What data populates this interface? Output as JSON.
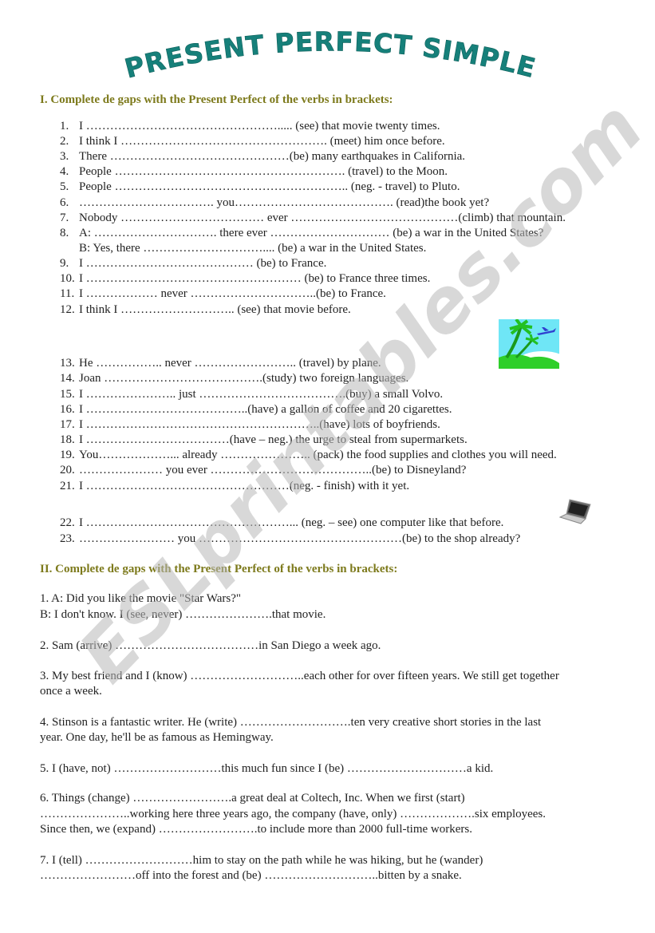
{
  "title": "PRESENT PERFECT SIMPLE",
  "watermark": "ESLprintables.com",
  "colors": {
    "title": "#16807a",
    "heading": "#7d7a1c",
    "watermark": "#bdbdbd"
  },
  "section1": {
    "heading": "I. Complete de gaps with the Present Perfect of the verbs in brackets:",
    "items": [
      {
        "n": "1.",
        "text": "I …………………………………………..... (see) that movie twenty times."
      },
      {
        "n": "2.",
        "text": "I think I ……………………………………………. (meet) him once before."
      },
      {
        "n": "3.",
        "text": "There ………………………………………(be) many earthquakes in California."
      },
      {
        "n": "4.",
        "text": "People …………………………………………………. (travel) to the Moon."
      },
      {
        "n": "5.",
        "text": "People ………………………………………………….. (neg. - travel) to Pluto."
      },
      {
        "n": "6.",
        "text": "……………………………. you…………………………………. (read)the book yet?"
      },
      {
        "n": "7.",
        "text": "Nobody ……………………………… ever ……………………………………(climb) that mountain."
      },
      {
        "n": "8.",
        "text": "A: …………………………. there ever ………………………… (be) a war in the United States?"
      },
      {
        "n": "",
        "text": "B: Yes, there ………………………….... (be) a war in the United States."
      },
      {
        "n": "9.",
        "text": "I …………………………………… (be) to France."
      },
      {
        "n": "10.",
        "text": "I ……………………………………………… (be) to France three times."
      },
      {
        "n": "11.",
        "text": "I ……………… never …………………………..(be) to France."
      },
      {
        "n": "12.",
        "text": "I think I ……………………….. (see) that movie before."
      },
      {
        "n": "13.",
        "text": "He …………….. never  …………………….. (travel) by plane."
      },
      {
        "n": "14.",
        "text": "Joan ………………………………….(study) two foreign languages."
      },
      {
        "n": "15.",
        "text": "I ………………….. just ……………………………….(buy) a small Volvo."
      },
      {
        "n": "16.",
        "text": "I …………………………………..(have) a gallon of coffee and 20 cigarettes."
      },
      {
        "n": "17.",
        "text": "I …………………………………………………..(have) lots of boyfriends."
      },
      {
        "n": "18.",
        "text": "I ………………………………(have – neg.) the urge to steal from supermarkets."
      },
      {
        "n": "19.",
        "text": "You………………... already ………………….. (pack) the food supplies and clothes you will need."
      },
      {
        "n": "20.",
        "text": "………………… you ever …………………………………..(be) to Disneyland?"
      },
      {
        "n": "21.",
        "text": "I ……………………………………………(neg. - finish) with it yet."
      },
      {
        "n": "22.",
        "text": "I ……………………………………………... (neg. – see)  one computer like that before."
      },
      {
        "n": "23.",
        "text": "…………………… you ……………………………………………(be) to the shop already?"
      }
    ]
  },
  "section2": {
    "heading": "II. Complete de gaps with the Present Perfect of the verbs in brackets:",
    "lines": [
      "1. A: Did you like the movie \"Star Wars?\"",
      "B: I don't know. I (see, never) ………………….that movie.",
      "2. Sam (arrive) ………………………………in San Diego a week ago.",
      "3. My best friend and I (know) ………………………..each other for over fifteen years. We still get together",
      "once a week.",
      "4. Stinson is a fantastic writer. He (write) ……………………….ten very creative short stories in the last",
      "year. One day, he'll be as famous as Hemingway.",
      "5. I (have, not) ………………………this much fun since I (be) …………………………a kid.",
      "6. Things (change) …………………….a great deal at Coltech, Inc. When we first (start)",
      "…………………..working here three years ago, the company (have, only) ……………….six employees.",
      "Since then, we (expand) …………………….to include more than 2000 full-time workers.",
      "7. I (tell) ………………………him to stay on the path while he was hiking, but he (wander)",
      "……………………off into the forest and (be) ………………………..bitten by a snake."
    ]
  }
}
